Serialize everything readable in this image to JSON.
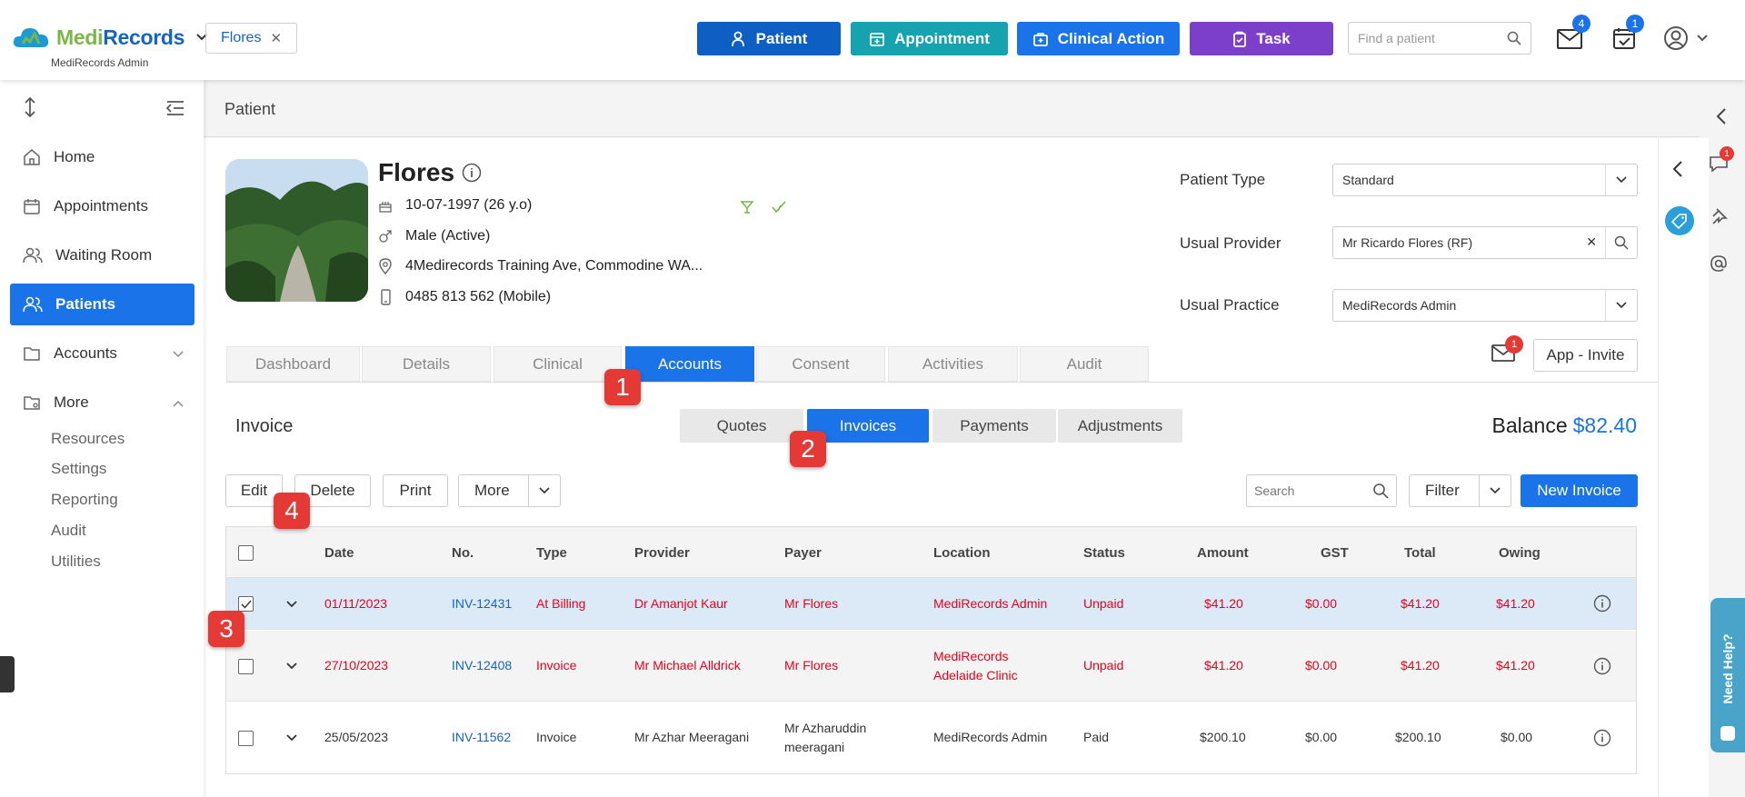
{
  "brand": {
    "name_a": "Medi",
    "name_b": "Records",
    "subtitle": "MediRecords Admin"
  },
  "patient_chip": {
    "label": "Flores"
  },
  "actions": {
    "patient": "Patient",
    "appointment": "Appointment",
    "clinical_action": "Clinical Action",
    "task": "Task"
  },
  "colors": {
    "patient": "#0d5fc4",
    "appointment": "#17a2b0",
    "clinical_action": "#1a73e8",
    "task": "#7b3fc9",
    "accent": "#1a73e8",
    "overdue": "#e8001c"
  },
  "search": {
    "placeholder": "Find a patient"
  },
  "badges": {
    "messages": "4",
    "tasks": "1",
    "chat": "1",
    "mail": "1"
  },
  "sidebar": {
    "items": [
      {
        "label": "Home",
        "icon": "home-icon"
      },
      {
        "label": "Appointments",
        "icon": "calendar-icon"
      },
      {
        "label": "Waiting Room",
        "icon": "people-icon"
      },
      {
        "label": "Patients",
        "icon": "people-icon"
      },
      {
        "label": "Accounts",
        "icon": "folder-icon"
      },
      {
        "label": "More",
        "icon": "folder-icon"
      }
    ],
    "sub": [
      "Resources",
      "Settings",
      "Reporting",
      "Audit",
      "Utilities"
    ]
  },
  "page": {
    "title": "Patient"
  },
  "patient": {
    "name": "Flores",
    "dob": "10-07-1997 (26 y.o)",
    "gender": "Male (Active)",
    "address": "4Medirecords Training Ave, Commodine WA...",
    "phone": "0485 813 562 (Mobile)"
  },
  "fields": {
    "type_label": "Patient Type",
    "type_value": "Standard",
    "provider_label": "Usual Provider",
    "provider_value": "Mr Ricardo Flores (RF)",
    "practice_label": "Usual Practice",
    "practice_value": "MediRecords Admin"
  },
  "tabs": [
    "Dashboard",
    "Details",
    "Clinical",
    "Accounts",
    "Consent",
    "Activities",
    "Audit"
  ],
  "app_invite": "App - Invite",
  "invoice": {
    "title": "Invoice",
    "balance_label": "Balance",
    "balance_value": "$82.40"
  },
  "segments": [
    "Quotes",
    "Invoices",
    "Payments",
    "Adjustments"
  ],
  "toolbar": {
    "edit": "Edit",
    "delete": "Delete",
    "print": "Print",
    "more": "More",
    "search_placeholder": "Search",
    "filter": "Filter",
    "new_invoice": "New Invoice"
  },
  "markers": [
    "1",
    "2",
    "3",
    "4"
  ],
  "table": {
    "headers": [
      "Date",
      "No.",
      "Type",
      "Provider",
      "Payer",
      "Location",
      "Status",
      "Amount",
      "GST",
      "Total",
      "Owing"
    ],
    "rows": [
      {
        "date": "01/11/2023",
        "no": "INV-12431",
        "type": "At Billing",
        "provider": "Dr Amanjot Kaur",
        "payer": "Mr Flores",
        "location": "MediRecords Admin",
        "location2": "",
        "status": "Unpaid",
        "amount": "$41.20",
        "gst": "$0.00",
        "total": "$41.20",
        "owing": "$41.20",
        "checked": true
      },
      {
        "date": "27/10/2023",
        "no": "INV-12408",
        "type": "Invoice",
        "provider": "Mr Michael Alldrick",
        "payer": "Mr Flores",
        "location": "MediRecords",
        "location2": "Adelaide Clinic",
        "status": "Unpaid",
        "amount": "$41.20",
        "gst": "$0.00",
        "total": "$41.20",
        "owing": "$41.20",
        "checked": false
      },
      {
        "date": "25/05/2023",
        "no": "INV-11562",
        "type": "Invoice",
        "provider": "Mr Azhar Meeragani",
        "payer": "Mr Azharuddin",
        "payer2": "meeragani",
        "location": "MediRecords Admin",
        "location2": "",
        "status": "Paid",
        "amount": "$200.10",
        "gst": "$0.00",
        "total": "$200.10",
        "owing": "$0.00",
        "checked": false
      }
    ]
  },
  "help": "Need Help?"
}
